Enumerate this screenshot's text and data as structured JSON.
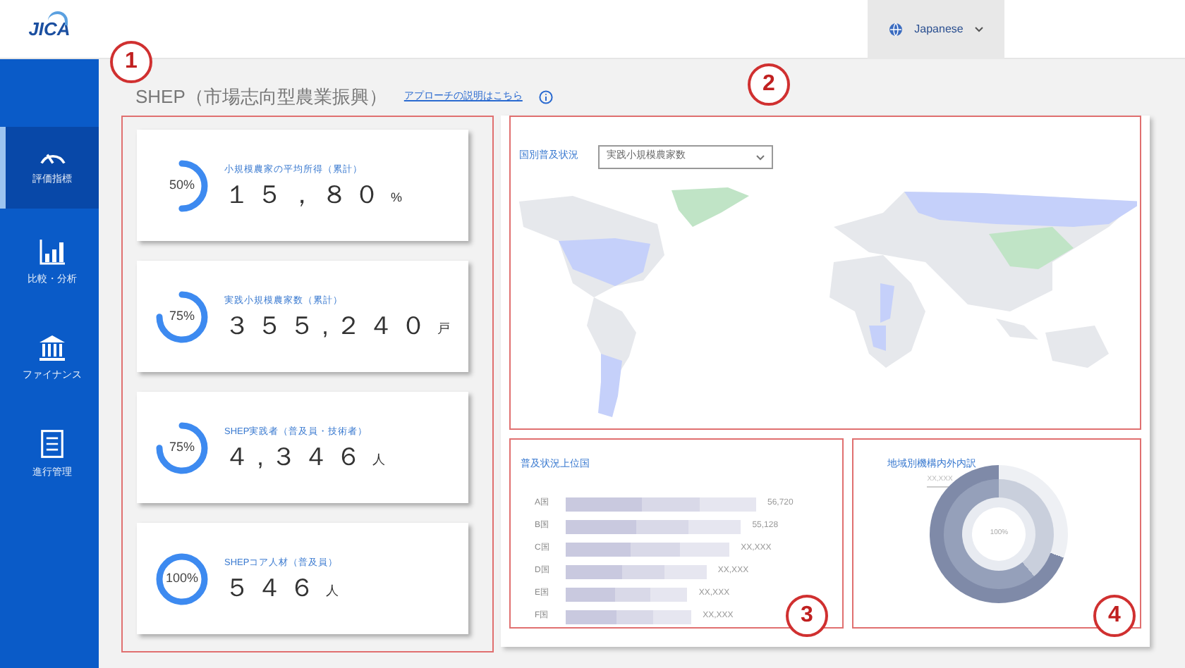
{
  "header": {
    "logo": "JICA",
    "language": "Japanese"
  },
  "sidebar": {
    "items": [
      {
        "label": "評価指標",
        "selected": true
      },
      {
        "label": "比較・分析",
        "selected": false
      },
      {
        "label": "ファイナンス",
        "selected": false
      },
      {
        "label": "進行管理",
        "selected": false
      }
    ]
  },
  "page": {
    "title": "SHEP（市場志向型農業振興）",
    "link": "アプローチの説明はこちら"
  },
  "kpi_cards": [
    {
      "label": "小規模農家の平均所得（累計）",
      "percent": "50%",
      "level": 0.5,
      "value": "１５，８０",
      "unit": "%"
    },
    {
      "label": "実践小規模農家数（累計）",
      "percent": "75%",
      "level": 0.75,
      "value": "３５５,２４０",
      "unit": "戸"
    },
    {
      "label": "SHEP実践者（普及員・技術者）",
      "percent": "75%",
      "level": 0.75,
      "value": "４,３４６",
      "unit": "人"
    },
    {
      "label": "SHEPコア人材（普及員）",
      "percent": "100%",
      "level": 1,
      "value": "５４６",
      "unit": "人"
    }
  ],
  "map_panel": {
    "title": "国別普及状況",
    "dropdown": "実践小規模農家数"
  },
  "ranking_panel": {
    "title": "普及状況上位国",
    "rows": [
      {
        "label": "A国",
        "value": "56,720"
      },
      {
        "label": "B国",
        "value": "55,128"
      },
      {
        "label": "C国",
        "value": "XX,XXX"
      },
      {
        "label": "D国",
        "value": "XX,XXX"
      },
      {
        "label": "E国",
        "value": "XX,XXX"
      },
      {
        "label": "F国",
        "value": "XX,XXX"
      }
    ]
  },
  "donut_panel": {
    "title": "地域別機構内外内訳",
    "legend": "XX,XXX",
    "center": "100%"
  },
  "callouts": [
    "1",
    "2",
    "3",
    "4"
  ]
}
